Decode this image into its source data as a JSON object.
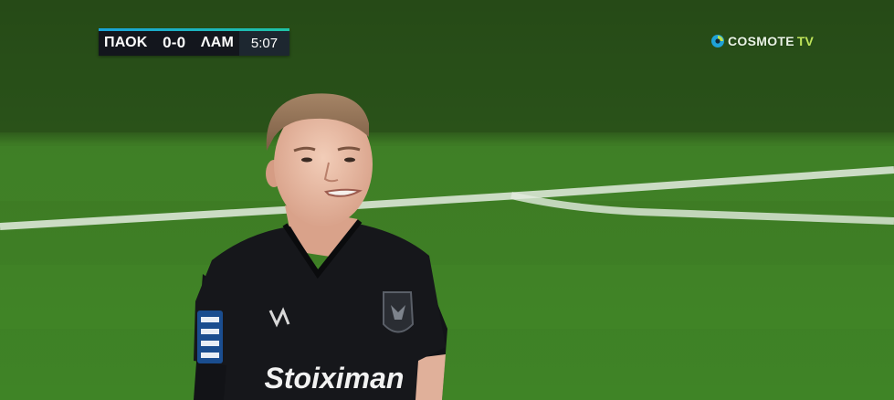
{
  "scorebug": {
    "home_team": "ΠΑΟΚ",
    "score": "0-0",
    "away_team": "ΛΑΜ",
    "clock": "5:07"
  },
  "broadcaster": {
    "name": "COSMOTE",
    "suffix": "TV"
  },
  "shirt": {
    "sponsor": "Stoiximan"
  },
  "colors": {
    "pitch": "#3d7a24",
    "scorebug_bg": "#13161d",
    "accent": "#19a3d8",
    "kit": "#15161a"
  }
}
